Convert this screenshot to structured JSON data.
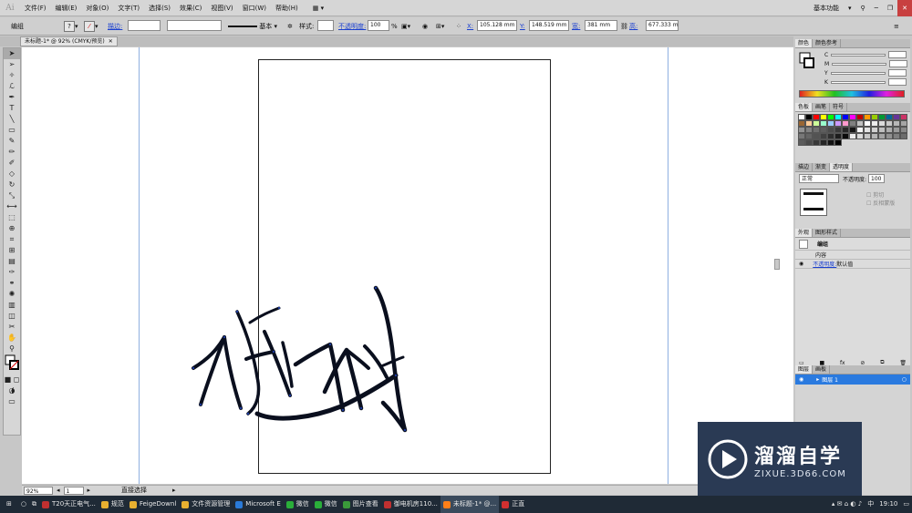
{
  "app": {
    "logo": "Ai",
    "workspace": "基本功能",
    "win_min": "─",
    "win_max": "❐",
    "win_close": "✕"
  },
  "menu": [
    "文件(F)",
    "编辑(E)",
    "对象(O)",
    "文字(T)",
    "选择(S)",
    "效果(C)",
    "视图(V)",
    "窗口(W)",
    "帮助(H)"
  ],
  "control": {
    "group_label": "编组",
    "stroke_label": "描边:",
    "stroke_weight": "",
    "profile": "",
    "basic": "基本",
    "style_label": "样式:",
    "opacity_label": "不透明度:",
    "opacity_value": "100",
    "percent": "%",
    "x_label": "X:",
    "x_value": "105.128 mm",
    "y_label": "Y:",
    "y_value": "148.519 mm",
    "w_label": "宽:",
    "w_value": "381 mm",
    "h_label": "高:",
    "h_value": "677.333 m"
  },
  "doc_tab": {
    "title": "未标题-1* @ 92% (CMYK/预览)",
    "close": "✕"
  },
  "status": {
    "zoom": "92%",
    "page": "1",
    "tool_name": "直接选择"
  },
  "panels": {
    "color_tabs": [
      "颜色",
      "颜色参考"
    ],
    "cmyk": [
      "C",
      "M",
      "Y",
      "K"
    ],
    "swatch_tabs": [
      "色板",
      "画笔",
      "符号"
    ],
    "transparency_tabs": [
      "描边",
      "渐变",
      "透明度"
    ],
    "blend_mode": "正常",
    "opacity_label": "不透明度:",
    "opacity_value": "100",
    "clip_label": "剪切",
    "invert_label": "反相蒙版",
    "appearance_tabs": [
      "外观",
      "图形样式"
    ],
    "appearance_group": "编组",
    "appearance_content": "内容",
    "appearance_opacity_link": "不透明度:",
    "appearance_opacity_value": "默认值",
    "layers_tabs": [
      "图层",
      "画板"
    ],
    "layer_name": "图层 1"
  },
  "swatch_colors": [
    "#ffffff",
    "#000000",
    "#ff0000",
    "#ffff00",
    "#00ff00",
    "#00ffff",
    "#0000ff",
    "#ff00ff",
    "#c00000",
    "#ff9900",
    "#99cc00",
    "#009933",
    "#006699",
    "#663399",
    "#cc3366",
    "#996633",
    "#ffcc99",
    "#ccff99",
    "#99ffcc",
    "#99ccff",
    "#cc99ff",
    "#ff99cc",
    "#808080",
    "#c0c0c0"
  ],
  "taskbar": {
    "items": [
      {
        "label": "T20天正电气...",
        "color": "#c03030"
      },
      {
        "label": "规范",
        "color": "#e8b030"
      },
      {
        "label": "FeigeDownl",
        "color": "#e8b030"
      },
      {
        "label": "文件资源管理",
        "color": "#e8b030"
      },
      {
        "label": "Microsoft E",
        "color": "#2a7ad8"
      },
      {
        "label": "微信",
        "color": "#2aae3a"
      },
      {
        "label": "微信",
        "color": "#2aae3a"
      },
      {
        "label": "图片查看",
        "color": "#3a9a3a"
      },
      {
        "label": "御电机房110...",
        "color": "#c03030"
      },
      {
        "label": "未标题-1* @...",
        "color": "#ff7f18"
      },
      {
        "label": "正直",
        "color": "#d03030"
      }
    ],
    "ime": "中",
    "time": "19:10"
  },
  "watermark": {
    "brand": "溜溜自学",
    "url": "ZIXUE.3D66.COM"
  }
}
